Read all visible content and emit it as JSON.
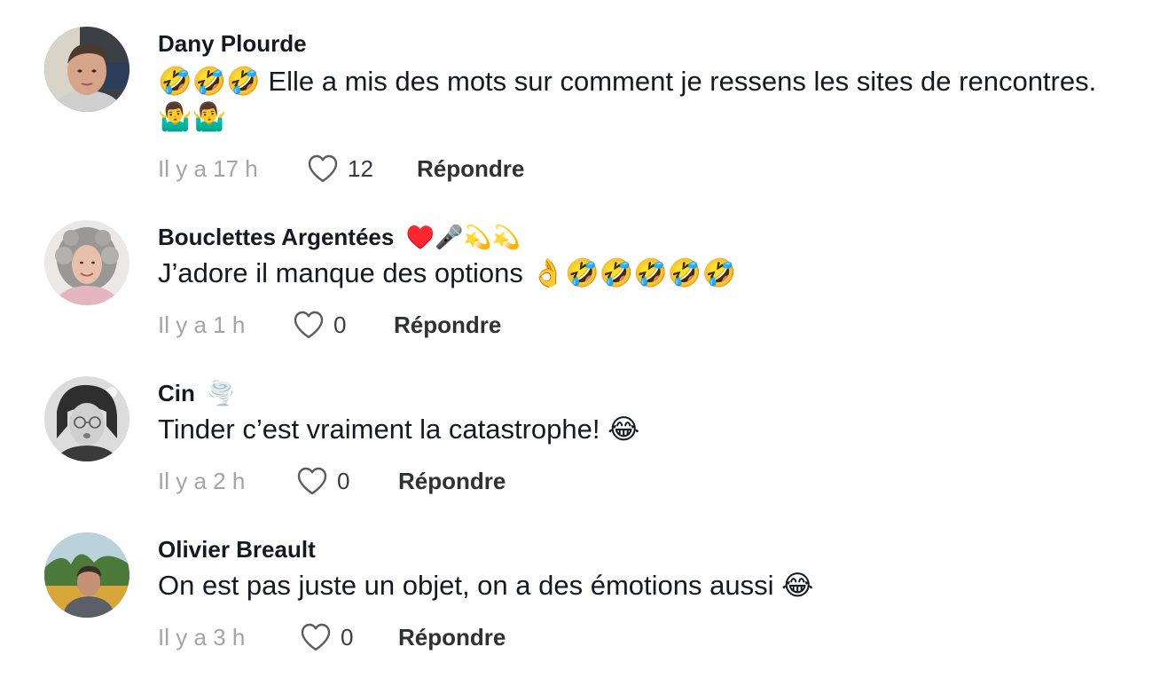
{
  "comments": [
    {
      "author": "Dany Plourde",
      "author_emoji": "",
      "text_emoji_prefix": "🤣🤣🤣",
      "text": "Elle a mis des mots sur comment je ressens les sites de rencontres.",
      "text_emoji_suffix": "🤷‍♂️🤷‍♂️",
      "time": "Il y a 17 h",
      "likes": "12",
      "reply_label": "Répondre",
      "avatar": "man-avatar"
    },
    {
      "author": "Bouclettes Argentées",
      "author_emoji": "♥️🎤💫💫",
      "text_emoji_prefix": "",
      "text": "J’adore il manque des options",
      "text_emoji_suffix": "👌🤣🤣🤣🤣🤣",
      "time": "Il y a 1 h",
      "likes": "0",
      "reply_label": "Répondre",
      "avatar": "curly-hair-avatar"
    },
    {
      "author": "Cin",
      "author_emoji": "🌪️",
      "text_emoji_prefix": "",
      "text": "Tinder c’est vraiment la catastrophe!",
      "text_emoji_suffix": "😂",
      "time": "Il y a 2 h",
      "likes": "0",
      "reply_label": "Répondre",
      "avatar": "woman-bw-avatar"
    },
    {
      "author": "Olivier Breault",
      "author_emoji": "",
      "text_emoji_prefix": "",
      "text": "On est pas juste un objet, on a des émotions aussi",
      "text_emoji_suffix": "😂",
      "time": "Il y a 3 h",
      "likes": "0",
      "reply_label": "Répondre",
      "avatar": "outdoor-avatar"
    }
  ]
}
